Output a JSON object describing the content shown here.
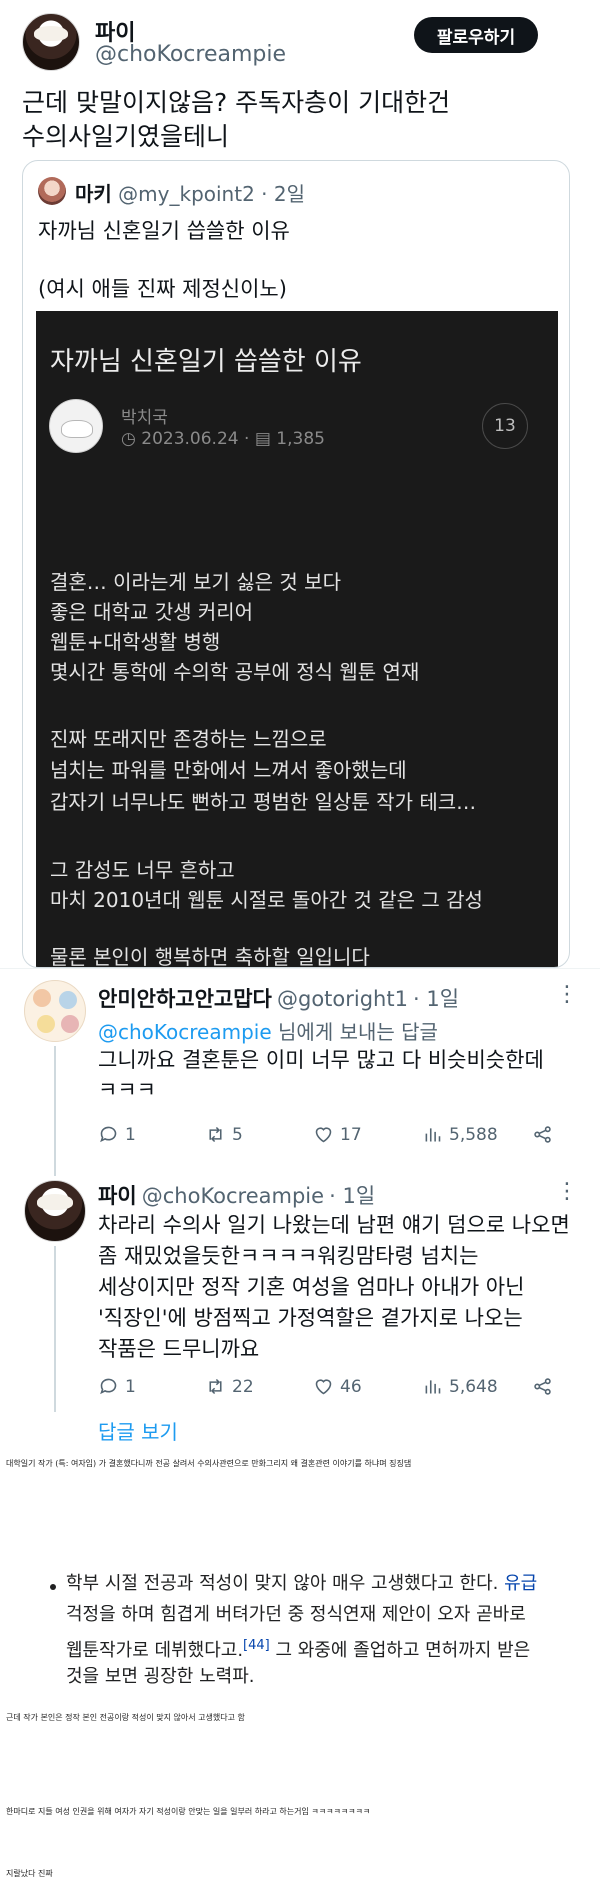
{
  "main_tweet": {
    "display_name": "파이",
    "handle": "@choKocreampie",
    "follow_label": "팔로우하기",
    "text_lines": [
      "근데 맞말이지않음? 주독자층이 기대한건",
      "수의사일기였을테니"
    ]
  },
  "quoted_tweet": {
    "display_name": "마키",
    "handle": "@my_kpoint2",
    "time": "· 2일",
    "text_line1": "자까님 신혼일기 씁쓸한 이유",
    "text_line2": "(여시 애들 진짜 제정신이노)",
    "post": {
      "title": "자까님 신혼일기 씁쓸한 이유",
      "author": "박치국",
      "date": "2023.06.24",
      "views": "1,385",
      "comment_count": "13",
      "lines": [
        "결혼… 이라는게 보기 싫은 것 보다",
        "좋은 대학교 갓생 커리어",
        "웹툰+대학생활 병행",
        "몇시간 통학에 수의학 공부에 정식 웹툰 연재",
        "진짜 또래지만 존경하는 느낌으로",
        "넘치는 파워를 만화에서 느껴서 좋아했는데",
        "갑자기 너무나도 뻔하고 평범한 일상툰 작가 테크…",
        "그 감성도 너무 흔하고",
        "마치 2010년대 웹툰 시절로 돌아간 것 같은 그 감성",
        "물론 본인이 행복하면 축하할 일입니다"
      ]
    }
  },
  "reply1": {
    "display_name": "안미안하고안고맙다",
    "handle": "@gotoright1",
    "time": "· 1일",
    "reply_to_handle": "@choKocreampie",
    "reply_to_suffix": "님에게 보내는 답글",
    "text_lines": [
      "그니까요 결혼툰은 이미 너무 많고 다 비슷비슷한데",
      "ㅋㅋㅋ"
    ],
    "stats": {
      "replies": "1",
      "retweets": "5",
      "likes": "17",
      "views": "5,588"
    }
  },
  "reply2": {
    "display_name": "파이",
    "handle": "@choKocreampie",
    "time": "· 1일",
    "text_lines": [
      "차라리 수의사 일기 나왔는데 남편 얘기 덤으로 나오면",
      "좀 재밌었을듯한ㅋㅋㅋㅋ워킹맘타령 넘치는",
      "세상이지만 정작 기혼 여성을 엄마나 아내가 아닌",
      "'직장인'에 방점찍고 가정역할은 곁가지로 나오는",
      "작품은 드무니까요"
    ],
    "stats": {
      "replies": "1",
      "retweets": "22",
      "likes": "46",
      "views": "5,648"
    },
    "show_replies_label": "답글 보기"
  },
  "caption1": "대학일기 작가 (특: 여자임) 가 결혼했다니까 전공 살려서 수의사관련으로 만화그리지 왜 결혼관련 이야기를 하냐며 징징댐",
  "wiki": {
    "line1_pre": "학부 시절 전공과 적성이 맞지 않아 매우 고생했다고 한다.",
    "line1_link": "유급",
    "line2": "걱정을 하며 힘겹게 버텨가던 중 정식연재 제안이 오자 곧바로",
    "line3_pre": "웹툰작가로 데뷔했다고.",
    "line3_ref": "[44]",
    "line3_post": "그 와중에 졸업하고 면허까지 받은",
    "line4": "것을 보면 굉장한 노력파."
  },
  "caption2": "근데 작가 본인은 정작 본인 전공이랑 적성이 맞지 않아서 고생했다고 함",
  "caption3": "한마디로 지들 여성 인권을 위해 여자가 자기 적성이랑 안맞는 일을 일부러 하라고 하는거임 ㅋㅋㅋㅋㅋㅋㅋㅋ",
  "caption4": "지랄났다 진짜",
  "icons": {
    "reply": "speech-bubble-icon",
    "retweet": "retweet-icon",
    "like": "heart-icon",
    "views": "bar-chart-icon",
    "share": "share-icon",
    "more": "more-dots-icon"
  }
}
